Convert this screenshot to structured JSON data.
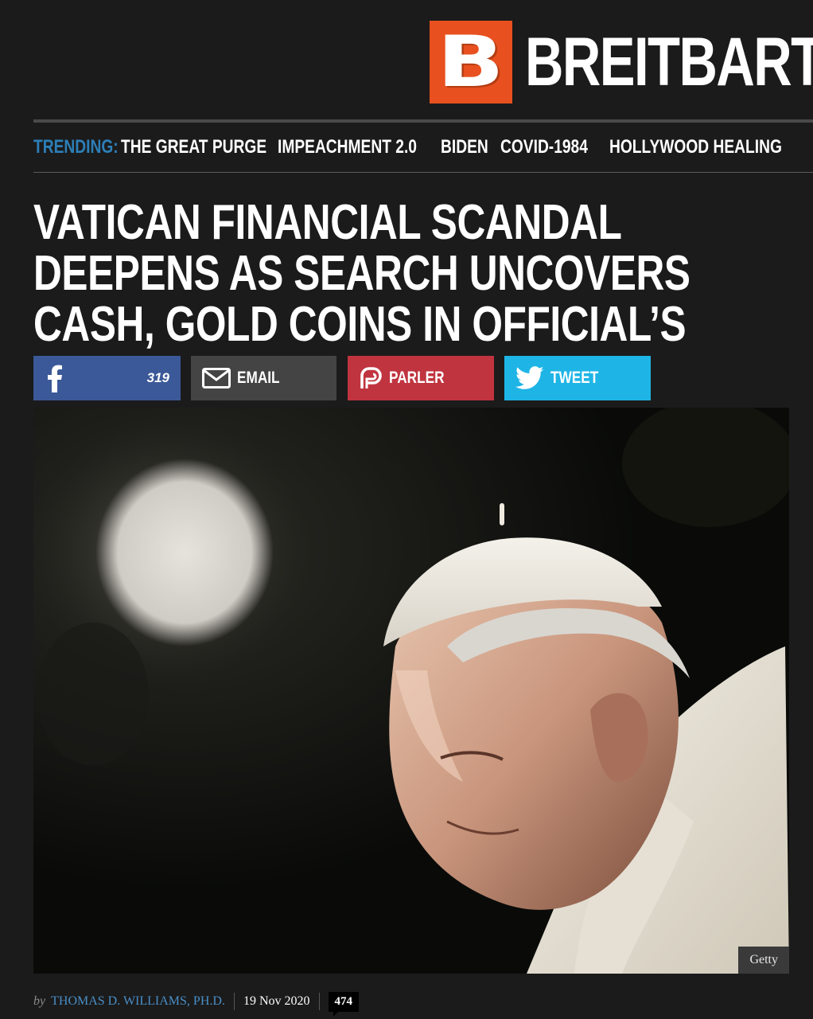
{
  "site": {
    "logo_letter": "B",
    "logo_word": "BREITBART",
    "brand_color": "#e8501f"
  },
  "trending": {
    "label": "TRENDING:",
    "items": [
      "THE GREAT PURGE",
      "IMPEACHMENT 2.0",
      "BIDEN",
      "COVID-1984",
      "HOLLYWOOD HEALING"
    ]
  },
  "article": {
    "headline": "VATICAN FINANCIAL SCANDAL DEEPENS AS SEARCH UNCOVERS CASH, GOLD COINS IN OFFICIAL’S HOME",
    "image_credit": "Getty",
    "byline_prefix": "by",
    "author": "THOMAS D. WILLIAMS, PH.D.",
    "date": "19 Nov 2020",
    "comment_count": "474"
  },
  "share": {
    "facebook_count": "319",
    "email_label": "EMAIL",
    "parler_label": "PARLER",
    "tweet_label": "TWEET",
    "colors": {
      "facebook": "#3b5998",
      "email": "#444444",
      "parler": "#c0343f",
      "twitter": "#1eb5e6"
    }
  }
}
